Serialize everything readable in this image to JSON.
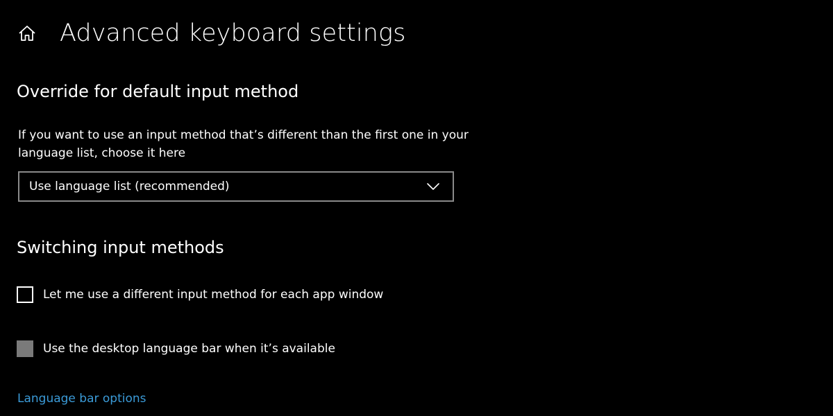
{
  "header": {
    "title": "Advanced keyboard settings",
    "home_icon": "home-icon"
  },
  "override_section": {
    "title": "Override for default input method",
    "description": "If you want to use an input method that’s different than the first one in your language list, choose it here",
    "dropdown": {
      "selected": "Use language list (recommended)",
      "icon": "chevron-down-icon"
    }
  },
  "switching_section": {
    "title": "Switching input methods",
    "options": [
      {
        "label": "Let me use a different input method for each app window",
        "checked": false,
        "enabled": true
      },
      {
        "label": "Use the desktop language bar when it’s available",
        "checked": false,
        "enabled": false
      }
    ],
    "link": "Language bar options"
  },
  "colors": {
    "background": "#000000",
    "text": "#ffffff",
    "link": "#3b9bd8",
    "border": "#8a8a8a",
    "disabled": "#7a7a7a"
  }
}
